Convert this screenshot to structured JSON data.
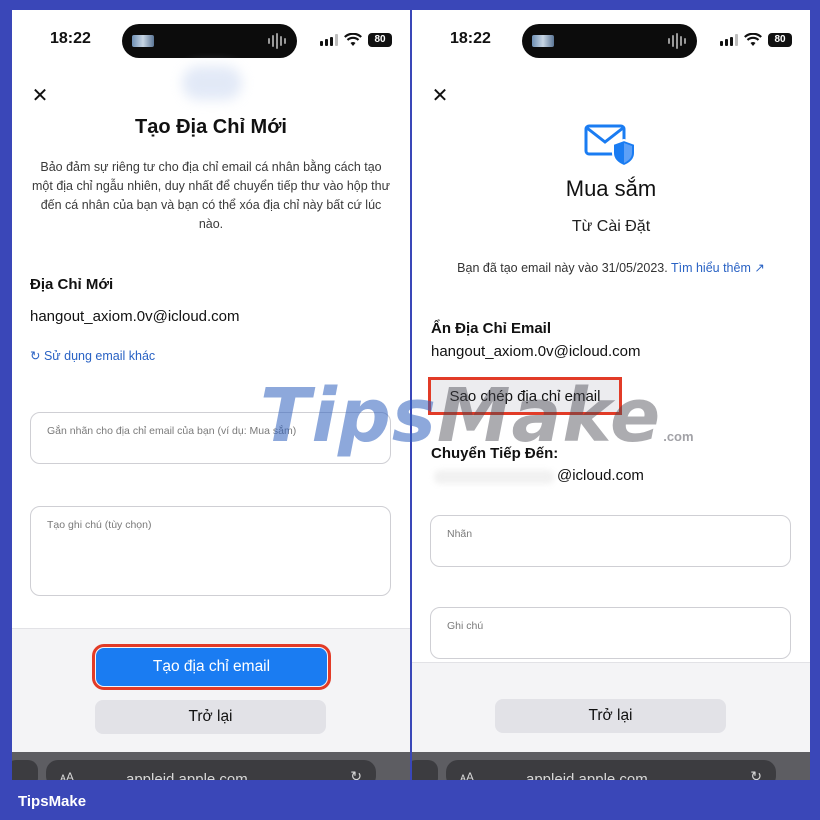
{
  "status": {
    "time": "18:22",
    "battery": "80"
  },
  "left": {
    "title": "Tạo Địa Chỉ Mới",
    "description": "Bảo đảm sự riêng tư cho địa chỉ email cá nhân bằng cách tạo một địa chỉ ngẫu nhiên, duy nhất để chuyển tiếp thư vào hộp thư đến cá nhân của bạn và bạn có thể xóa địa chỉ này bất cứ lúc nào.",
    "new_address_label": "Địa Chỉ Mới",
    "email": "hangout_axiom.0v@icloud.com",
    "use_other_link": "↻ Sử dụng email khác",
    "label_placeholder": "Gắn nhãn cho địa chỉ email của bạn (ví dụ: Mua sắm)",
    "note_placeholder": "Tạo ghi chú (tùy chọn)",
    "create_button": "Tạo địa chỉ email",
    "back_button": "Trở lại",
    "url": "appleid.apple.com"
  },
  "right": {
    "title": "Mua sắm",
    "subtitle": "Từ Cài Đặt",
    "created_text": "Bạn đã tạo email này vào 31/05/2023.",
    "learn_more": "Tìm hiểu thêm ↗",
    "hide_label": "Ẩn Địa Chỉ Email",
    "email": "hangout_axiom.0v@icloud.com",
    "copy_button": "Sao chép địa chỉ email",
    "forward_label": "Chuyển Tiếp Đến:",
    "forward_email": "@icloud.com",
    "label_field": "Nhãn",
    "note_field": "Ghi chú",
    "back_button": "Trở lại",
    "url": "appleid.apple.com"
  },
  "watermark": {
    "tips": "Tips",
    "make": "Make",
    "com": ".com"
  },
  "footer": {
    "brand": "TipsMake"
  },
  "colors": {
    "accent": "#1a7cf2",
    "highlight": "#e23b27",
    "frame": "#3a47b8",
    "link": "#2962c4"
  }
}
